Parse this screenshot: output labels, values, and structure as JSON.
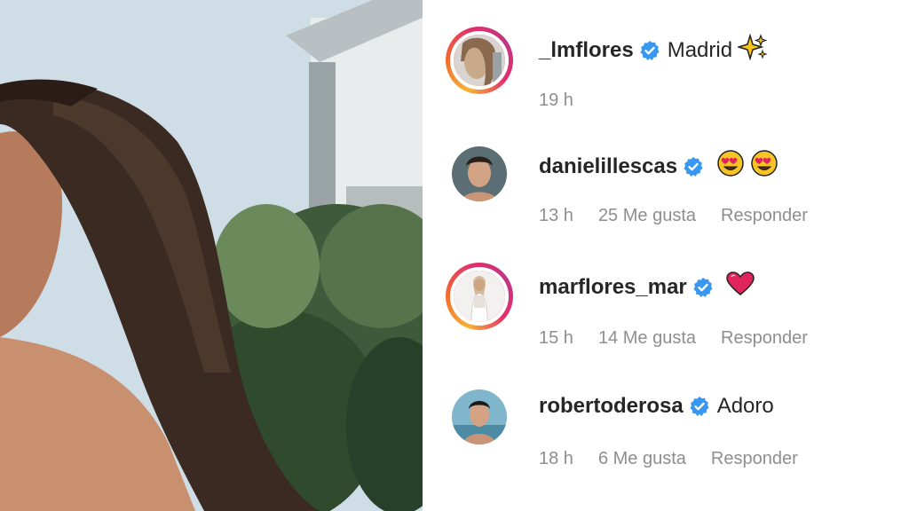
{
  "comments": [
    {
      "username": "_lmflores",
      "verified": true,
      "text": "Madrid",
      "emoji": "sparkles-icon",
      "time": "19 h",
      "likes": "",
      "reply": "",
      "avatar_style": "story"
    },
    {
      "username": "danielillescas",
      "verified": true,
      "text": "",
      "emoji": "heart-eyes-icon",
      "time": "13 h",
      "likes": "25 Me gusta",
      "reply": "Responder",
      "avatar_style": "plain"
    },
    {
      "username": "marflores_mar",
      "verified": true,
      "text": "",
      "emoji": "red-heart-icon",
      "time": "15 h",
      "likes": "14 Me gusta",
      "reply": "Responder",
      "avatar_style": "story"
    },
    {
      "username": "robertoderosa",
      "verified": true,
      "text": "Adoro",
      "emoji": "",
      "time": "18 h",
      "likes": "6 Me gusta",
      "reply": "Responder",
      "avatar_style": "plain"
    }
  ],
  "colors": {
    "verified": "#3897f0",
    "meta_text": "#8e8e8e",
    "username": "#262626",
    "heart": "#e0245e",
    "emoji_face": "#f7c325"
  }
}
